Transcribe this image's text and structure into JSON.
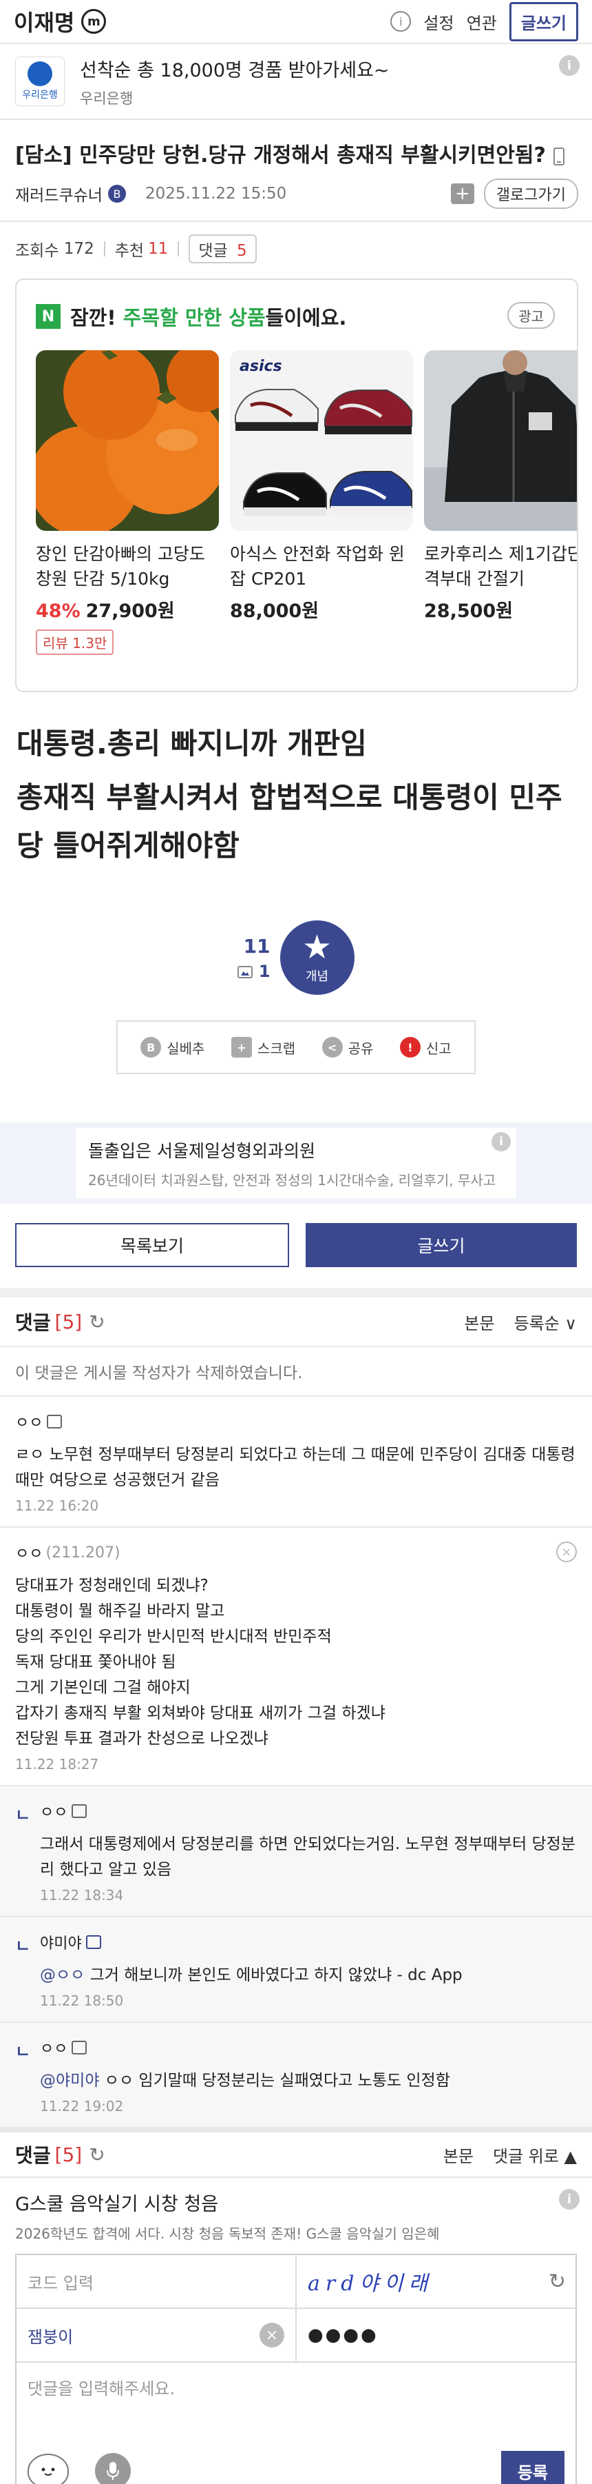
{
  "header": {
    "title": "이재명",
    "badge": "m",
    "info": "i",
    "settings": "설정",
    "related": "연관",
    "write": "글쓰기"
  },
  "top_ad": {
    "logo_text": "우리은행",
    "title": "선착순 총 18,000명 경품 받아가세요~",
    "sponsor": "우리은행",
    "info": "i"
  },
  "post": {
    "title": "[담소] 민주당만 당헌.당규 개정해서 총재직 부활시키면안됨?",
    "author": "재러드쿠슈너",
    "author_badge": "B",
    "date": "2025.11.22 15:50",
    "plus": "+",
    "gallery_button": "갤로그가기",
    "views_label": "조회수",
    "views": "172",
    "recommend_label": "추천",
    "recommend": "11",
    "comments_label": "댓글",
    "comments": "5",
    "body": [
      "대통령.총리 빠지니까 개판임",
      "총재직 부활시켜서 합법적으로 대통령이 민주당 틀어쥐게해야함"
    ]
  },
  "product_card": {
    "n_icon": "N",
    "lead": "잠깐!",
    "highlight": "주목할 만한 상품",
    "tail": "들이에요.",
    "ad_badge": "광고",
    "items": [
      {
        "name": "장인 단감아빠의 고당도 창원 단감 5/10kg",
        "discount": "48%",
        "price": "27,900원",
        "review": "리뷰 1.3만"
      },
      {
        "name": "아식스 안전화 작업화 윈잡 CP201",
        "price": "88,000원"
      },
      {
        "name": "로카후리스 제1기갑단 전격부대 간절기",
        "price": "28,500원"
      }
    ],
    "brand_text": "asics"
  },
  "recommend": {
    "count": "11",
    "fix_count": "1",
    "button_label": "개념",
    "star": "★"
  },
  "actions": [
    {
      "icon": "B",
      "label": "실베추"
    },
    {
      "icon": "+",
      "label": "스크랩"
    },
    {
      "icon": "<",
      "label": "공유"
    },
    {
      "icon": "!",
      "label": "신고"
    }
  ],
  "mid_ad": {
    "title": "돌출입은 서울제일성형외과의원",
    "desc": "26년데이터 치과원스탑, 안전과 정성의 1시간대수술, 리얼후기, 무사고",
    "info": "i"
  },
  "buttons": {
    "list": "목록보기",
    "write": "글쓰기"
  },
  "comments_header": {
    "label": "댓글",
    "count": "[5]",
    "refresh": "↻",
    "body": "본문",
    "sort": "등록순 ∨",
    "up": "댓글 위로 ▲"
  },
  "deleted_notice": "이 댓글은 게시물 작성자가 삭제하였습니다.",
  "comments": [
    {
      "nick": "ㅇㅇ",
      "ip": "",
      "text": "ㄹㅇ 노무현 정부때부터 당정분리 되었다고 하는데 그 때문에 민주당이 김대중 대통령때만 여당으로 성공했던거 같음",
      "date": "11.22 16:20"
    },
    {
      "nick": "ㅇㅇ",
      "ip": "(211.207)",
      "text": "당대표가 정청래인데 되겠냐?\n대통령이 뭘 해주길 바라지 말고\n당의 주인인 우리가 반시민적 반시대적 반민주적\n독재 당대표 쫓아내야 됨\n그게 기본인데 그걸 해야지\n갑자기 총재직 부활 외쳐봐야 당대표 새끼가 그걸 하겠냐\n전당원 투표 결과가 찬성으로 나오겠냐",
      "date": "11.22 18:27",
      "close": "×"
    }
  ],
  "replies": [
    {
      "marker": "ㄴ",
      "nick": "ㅇㅇ",
      "at": "",
      "text": "그래서 대통령제에서 당정분리를 하면 안되었다는거임. 노무현 정부때부터 당정분리 했다고 알고 있음",
      "date": "11.22 18:34"
    },
    {
      "marker": "ㄴ",
      "nick": "야미야",
      "at": "@ㅇㅇ",
      "text": " 그거 해보니까 본인도 에바였다고 하지 않았냐 - dc App",
      "date": "11.22 18:50"
    },
    {
      "marker": "ㄴ",
      "nick": "ㅇㅇ",
      "at": "@야미야",
      "text": " ㅇㅇ 임기말때 당정분리는 실패였다고 노통도 인정함",
      "date": "11.22 19:02"
    }
  ],
  "bottom_ad": {
    "title": "G스쿨 음악실기 시창 청음",
    "desc": "2026학년도 합격에 서다. 시창 청음 독보적 존재! G스쿨 음악실기 임은혜",
    "info": "i"
  },
  "form": {
    "code_placeholder": "코드 입력",
    "captcha": "ard야이래",
    "refresh": "↻",
    "nick": "잼붕이",
    "clear": "×",
    "password": "●●●●",
    "comment_placeholder": "댓글을 입력해주세요.",
    "submit": "등록"
  },
  "colors": {
    "accent": "#3b4890",
    "red": "#d63a3a",
    "green": "#29a84a"
  }
}
